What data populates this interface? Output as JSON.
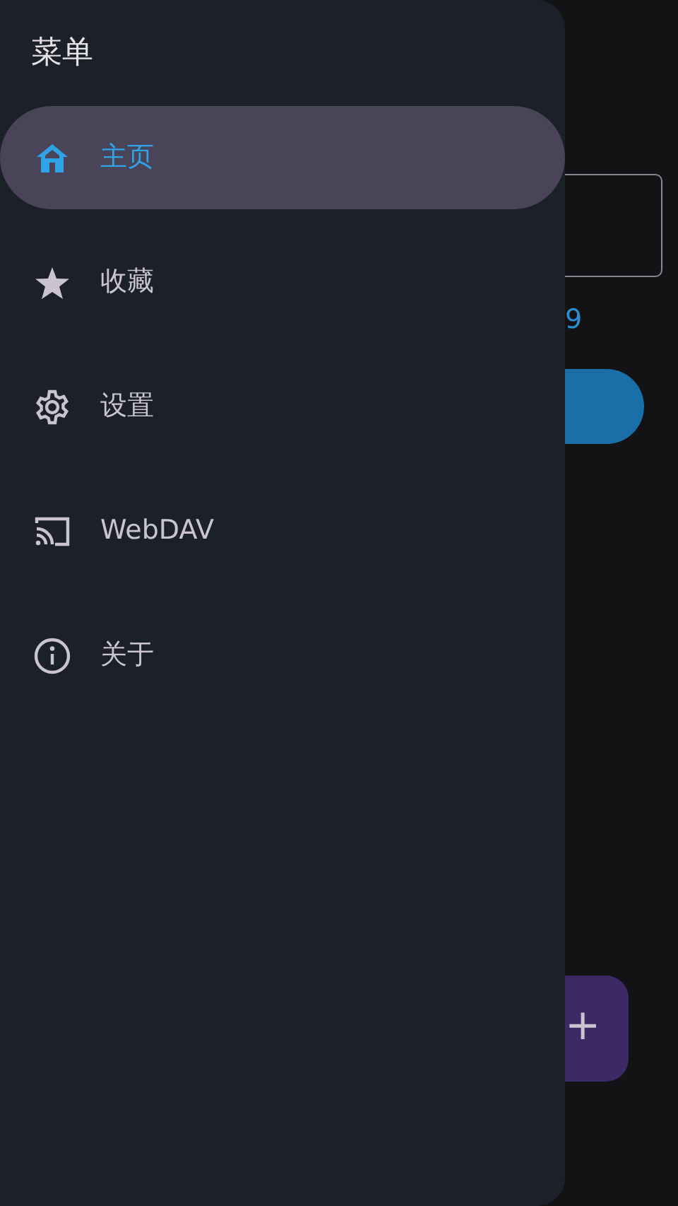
{
  "drawer": {
    "title": "菜单",
    "items": [
      {
        "label": "主页",
        "kind": "home",
        "selected": true
      },
      {
        "label": "收藏",
        "kind": "star",
        "selected": false
      },
      {
        "label": "设置",
        "kind": "gear",
        "selected": false
      },
      {
        "label": "WebDAV",
        "kind": "cast",
        "selected": false
      },
      {
        "label": "关于",
        "kind": "info",
        "selected": false
      }
    ]
  },
  "main": {
    "helper_text": "9",
    "fab_label": "+"
  }
}
